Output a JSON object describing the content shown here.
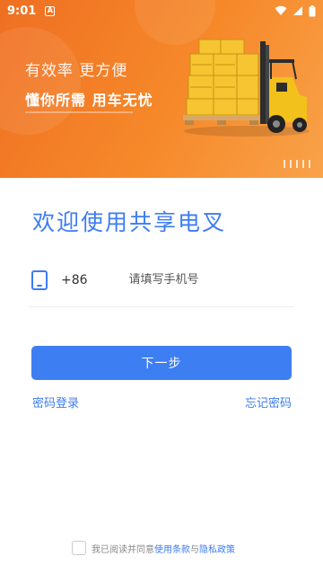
{
  "status_bar": {
    "time": "9:01",
    "notification_letter": "A",
    "icons": [
      "wifi-icon",
      "signal-icon",
      "battery-icon"
    ]
  },
  "banner": {
    "slogan_line1": "有效率 更方便",
    "slogan_line2": "懂你所需 用车无忧",
    "illustration": "forklift-with-crates"
  },
  "login": {
    "welcome_title": "欢迎使用共享电叉",
    "country_code": "+86",
    "phone_placeholder": "请填写手机号",
    "phone_value": "",
    "next_label": "下一步",
    "password_login": "密码登录",
    "forgot_password": "忘记密码"
  },
  "agreement": {
    "prefix": "我已阅读并同意",
    "terms": "使用条款",
    "conjunction": "与",
    "privacy": "隐私政策",
    "checked": false
  },
  "colors": {
    "accent": "#3d7cf3",
    "banner_orange": "#f6892a"
  }
}
